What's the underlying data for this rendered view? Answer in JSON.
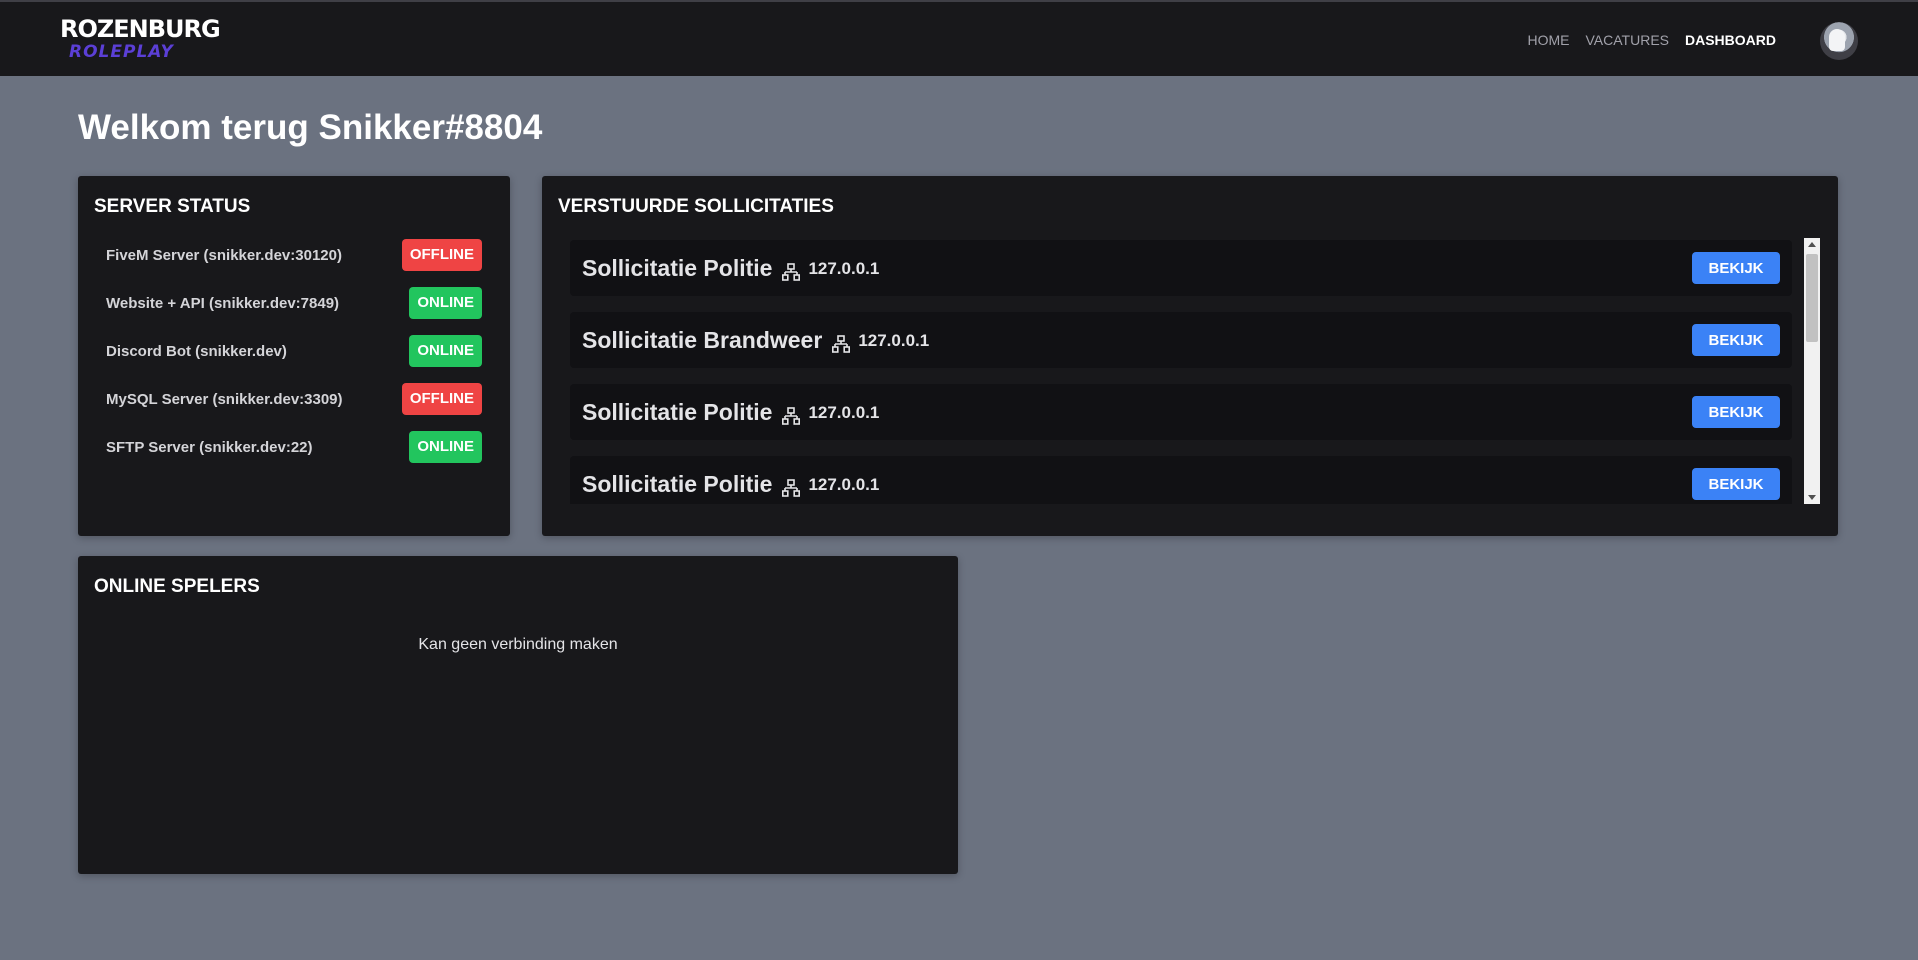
{
  "brand": {
    "name_top": "ROZENBURG",
    "name_bottom": "ROLEPLAY"
  },
  "nav": {
    "items": [
      {
        "label": "HOME"
      },
      {
        "label": "VACATURES"
      },
      {
        "label": "DASHBOARD",
        "active": true
      }
    ]
  },
  "avatar": {
    "icon": "user-avatar"
  },
  "welcome": "Welkom terug Snikker#8804",
  "server_status": {
    "title": "SERVER STATUS",
    "rows": [
      {
        "label": "FiveM Server (snikker.dev:30120)",
        "status": "OFFLINE"
      },
      {
        "label": "Website + API (snikker.dev:7849)",
        "status": "ONLINE"
      },
      {
        "label": "Discord Bot (snikker.dev)",
        "status": "ONLINE"
      },
      {
        "label": "MySQL Server (snikker.dev:3309)",
        "status": "OFFLINE"
      },
      {
        "label": "SFTP Server (snikker.dev:22)",
        "status": "ONLINE"
      }
    ]
  },
  "applications": {
    "title": "VERSTUURDE SOLLICITATIES",
    "button_label": "BEKIJK",
    "items": [
      {
        "title": "Sollicitatie Politie",
        "ip": "127.0.0.1"
      },
      {
        "title": "Sollicitatie Brandweer",
        "ip": "127.0.0.1"
      },
      {
        "title": "Sollicitatie Politie",
        "ip": "127.0.0.1"
      },
      {
        "title": "Sollicitatie Politie",
        "ip": "127.0.0.1"
      }
    ]
  },
  "online_players": {
    "title": "ONLINE SPELERS",
    "message": "Kan geen verbinding maken"
  },
  "colors": {
    "page_bg": "#6b7280",
    "panel_bg": "#18181b",
    "item_bg": "#111114",
    "offline": "#ef4444",
    "online": "#22c55e",
    "button": "#3b82f6",
    "brand_purple": "#5b3fd6"
  }
}
